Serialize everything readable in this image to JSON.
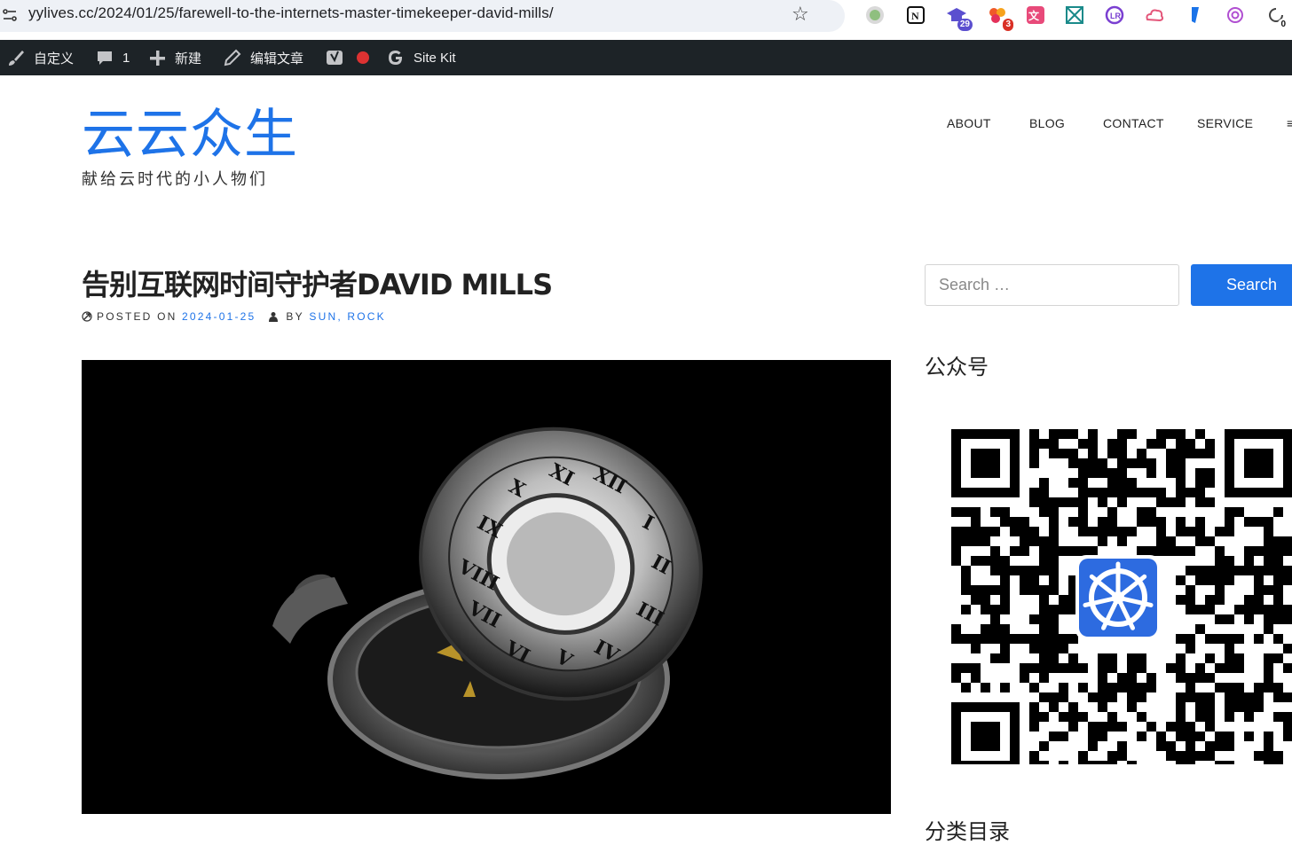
{
  "browser": {
    "url": "yylives.cc/2024/01/25/farewell-to-the-internets-master-timekeeper-david-mills/",
    "extensions": [
      {
        "name": "circle-ext-icon",
        "badge": ""
      },
      {
        "name": "notion-ext-icon",
        "badge": ""
      },
      {
        "name": "graduation-ext-icon",
        "badge": "29"
      },
      {
        "name": "dots-ext-icon",
        "badge": "3"
      },
      {
        "name": "translate-ext-icon",
        "badge": ""
      },
      {
        "name": "grid-ext-icon",
        "badge": ""
      },
      {
        "name": "lr-ext-icon",
        "badge": ""
      },
      {
        "name": "cloud-ext-icon",
        "badge": ""
      },
      {
        "name": "tag-ext-icon",
        "badge": ""
      },
      {
        "name": "openai-ext-icon",
        "badge": ""
      },
      {
        "name": "clock-ext-icon",
        "badge": "0"
      }
    ]
  },
  "admin_bar": {
    "customize": "自定义",
    "comments_count": "1",
    "new": "新建",
    "edit_post": "编辑文章",
    "site_kit": "Site Kit"
  },
  "header": {
    "site_title": "云云众生",
    "site_description": "献给云时代的小人物们",
    "nav": [
      "ABOUT",
      "BLOG",
      "CONTACT",
      "SERVICE"
    ],
    "nav_more": "≡"
  },
  "post": {
    "title": "告别互联网时间守护者DAVID MILLS",
    "posted_on_label": "POSTED ON",
    "date": "2024-01-25",
    "by_label": "BY",
    "author": "SUN, ROCK"
  },
  "sidebar": {
    "search_placeholder": "Search …",
    "search_button": "Search",
    "widget_wechat": "公众号",
    "widget_categories": "分类目录"
  },
  "colors": {
    "accent": "#1e73e8",
    "admin_bar": "#1d2327"
  }
}
